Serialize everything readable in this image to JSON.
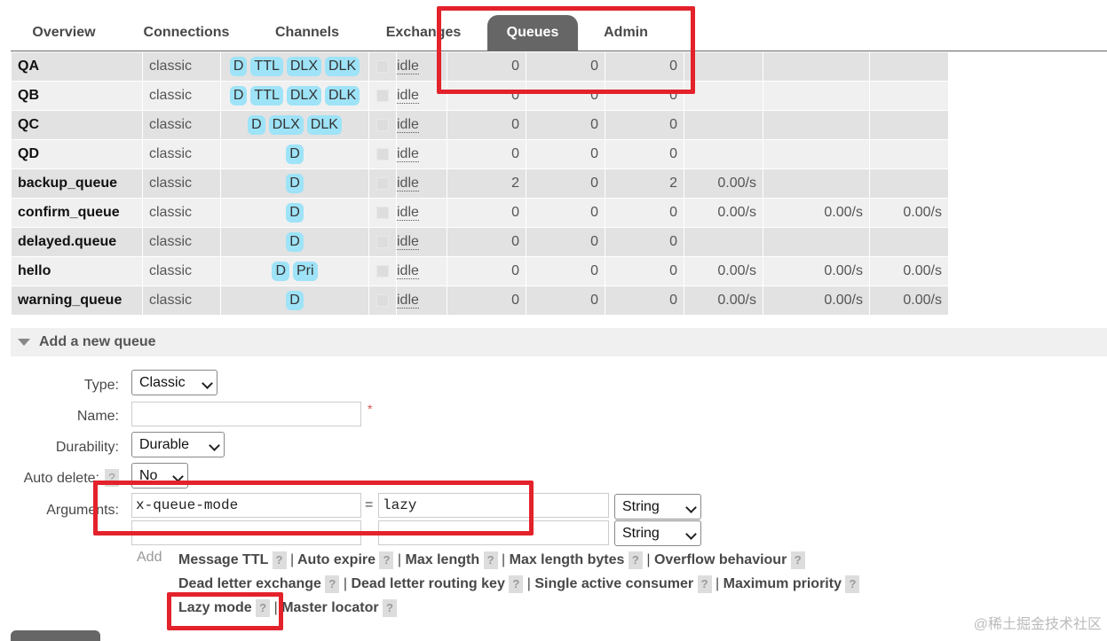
{
  "tabs": [
    "Overview",
    "Connections",
    "Channels",
    "Exchanges",
    "Queues",
    "Admin"
  ],
  "active_tab": "Queues",
  "queues": [
    {
      "name": "QA",
      "type": "classic",
      "features": [
        "D",
        "TTL",
        "DLX",
        "DLK"
      ],
      "state": "idle",
      "ready": "0",
      "unacked": "0",
      "total": "0",
      "incoming": "",
      "deliver": "",
      "ack": ""
    },
    {
      "name": "QB",
      "type": "classic",
      "features": [
        "D",
        "TTL",
        "DLX",
        "DLK"
      ],
      "state": "idle",
      "ready": "0",
      "unacked": "0",
      "total": "0",
      "incoming": "",
      "deliver": "",
      "ack": ""
    },
    {
      "name": "QC",
      "type": "classic",
      "features": [
        "D",
        "DLX",
        "DLK"
      ],
      "state": "idle",
      "ready": "0",
      "unacked": "0",
      "total": "0",
      "incoming": "",
      "deliver": "",
      "ack": ""
    },
    {
      "name": "QD",
      "type": "classic",
      "features": [
        "D"
      ],
      "state": "idle",
      "ready": "0",
      "unacked": "0",
      "total": "0",
      "incoming": "",
      "deliver": "",
      "ack": ""
    },
    {
      "name": "backup_queue",
      "type": "classic",
      "features": [
        "D"
      ],
      "state": "idle",
      "ready": "2",
      "unacked": "0",
      "total": "2",
      "incoming": "0.00/s",
      "deliver": "",
      "ack": ""
    },
    {
      "name": "confirm_queue",
      "type": "classic",
      "features": [
        "D"
      ],
      "state": "idle",
      "ready": "0",
      "unacked": "0",
      "total": "0",
      "incoming": "0.00/s",
      "deliver": "0.00/s",
      "ack": "0.00/s"
    },
    {
      "name": "delayed.queue",
      "type": "classic",
      "features": [
        "D"
      ],
      "state": "idle",
      "ready": "0",
      "unacked": "0",
      "total": "0",
      "incoming": "",
      "deliver": "",
      "ack": ""
    },
    {
      "name": "hello",
      "type": "classic",
      "features": [
        "D",
        "Pri"
      ],
      "state": "idle",
      "ready": "0",
      "unacked": "0",
      "total": "0",
      "incoming": "0.00/s",
      "deliver": "0.00/s",
      "ack": "0.00/s"
    },
    {
      "name": "warning_queue",
      "type": "classic",
      "features": [
        "D"
      ],
      "state": "idle",
      "ready": "0",
      "unacked": "0",
      "total": "0",
      "incoming": "0.00/s",
      "deliver": "0.00/s",
      "ack": "0.00/s"
    }
  ],
  "add_queue": {
    "title": "Add a new queue",
    "type_label": "Type:",
    "type_value": "Classic",
    "name_label": "Name:",
    "required_mark": "*",
    "durability_label": "Durability:",
    "durability_value": "Durable",
    "auto_delete_label": "Auto delete:",
    "auto_delete_help": "?",
    "auto_delete_value": "No",
    "arguments_label": "Arguments:",
    "arg1_key": "x-queue-mode",
    "equals": "=",
    "arg1_value": "lazy",
    "arg1_type": "String",
    "arg2_type": "String",
    "add_label": "Add",
    "help": "?",
    "pipe": "|",
    "options_row1": [
      "Message TTL",
      "Auto expire",
      "Max length",
      "Max length bytes",
      "Overflow behaviour"
    ],
    "options_row2": [
      "Dead letter exchange",
      "Dead letter routing key",
      "Single active consumer",
      "Maximum priority"
    ],
    "options_row3": [
      "Lazy mode",
      "Master locator"
    ]
  },
  "watermark": "@稀土掘金技术社区",
  "colors": {
    "badge": "#9ee3f7",
    "active_tab": "#666666",
    "highlight": "#e3222b"
  }
}
